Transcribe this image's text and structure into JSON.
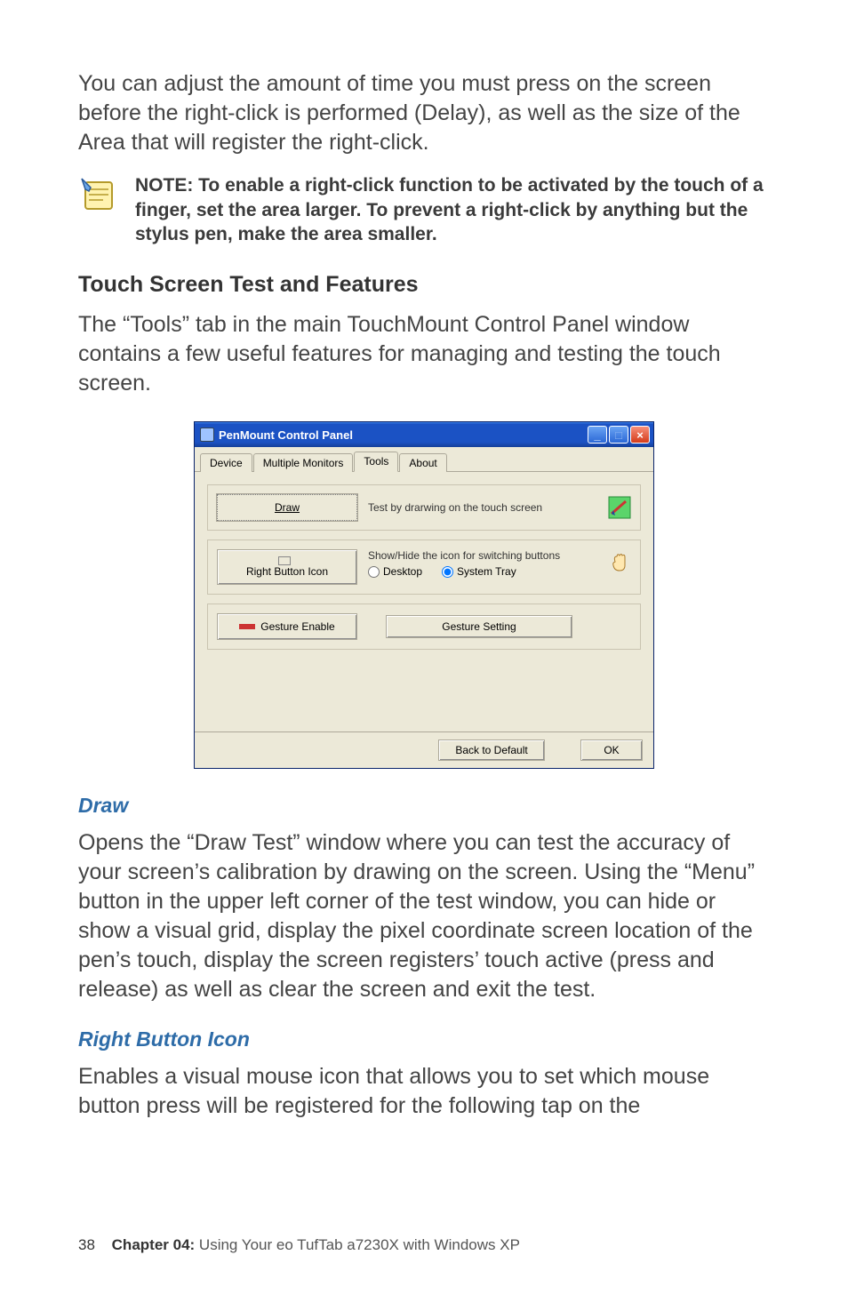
{
  "intro_para": "You can adjust the amount of time you must press on the screen before the right-click is performed (Delay), as well as the size of the Area that will register the right-click.",
  "note_text": "NOTE: To enable a right-click function to be activated by the touch of a finger, set the area larger. To prevent a right-click by anything but the stylus pen, make the area smaller.",
  "heading_touch": "Touch Screen Test and Features",
  "touch_para": "The “Tools” tab in the main TouchMount Control Panel window contains a few useful features for managing and testing the touch screen.",
  "window": {
    "title": "PenMount Control Panel",
    "tabs": {
      "device": "Device",
      "multiple": "Multiple Monitors",
      "tools": "Tools",
      "about": "About"
    },
    "draw_btn": "Draw",
    "draw_desc": "Test by drarwing on the  touch screen",
    "rbi_btn": "Right Button Icon",
    "rbi_desc": "Show/Hide the icon for switching buttons",
    "radio_desktop": "Desktop",
    "radio_systray": "System Tray",
    "gesture_enable": "Gesture Enable",
    "gesture_setting": "Gesture Setting",
    "back_default": "Back to Default",
    "ok": "OK"
  },
  "draw_heading": "Draw",
  "draw_para": "Opens the “Draw Test” window where you can test the accuracy of your screen’s calibration by drawing on the screen. Using the “Menu” button in the upper left corner of the test window, you can hide or show a visual grid, display the pixel coordinate screen location of the pen’s touch, display the screen registers’ touch active (press and release) as well as clear the screen and exit the test.",
  "rbi_heading": "Right Button Icon",
  "rbi_para": "Enables a visual mouse icon that allows you to set which mouse button press will be registered for the following tap on the",
  "footer": {
    "page": "38",
    "chapter": "Chapter 04:",
    "rest": " Using Your eo TufTab a7230X with Windows XP"
  }
}
